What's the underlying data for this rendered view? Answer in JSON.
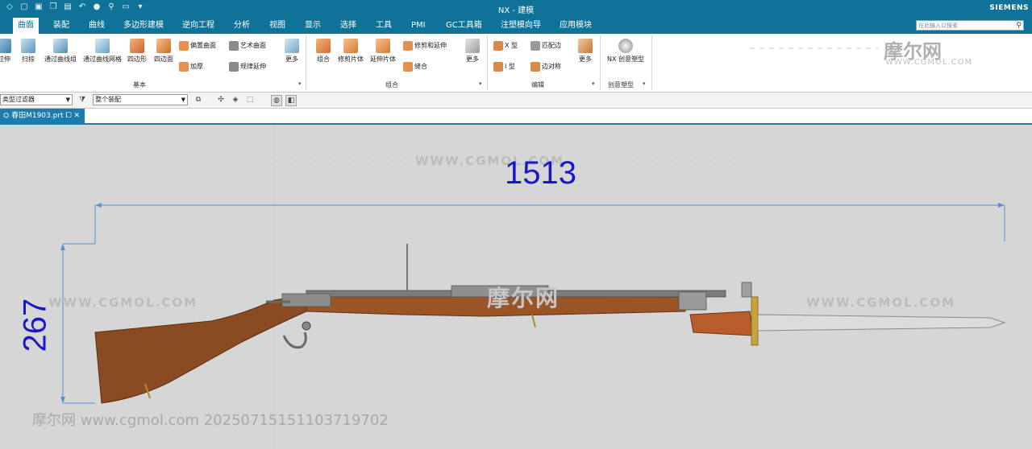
{
  "window": {
    "title": "NX - 建模",
    "brand": "SIEMENS"
  },
  "menu": {
    "tabs": [
      "曲面",
      "装配",
      "曲线",
      "多边形建模",
      "逆向工程",
      "分析",
      "视图",
      "显示",
      "选择",
      "工具",
      "PMI",
      "GC工具箱",
      "注塑模向导",
      "应用模块"
    ]
  },
  "search": {
    "placeholder": "在此输入以搜索"
  },
  "ribbon": {
    "basic": {
      "label": "基本",
      "buttons": [
        "拉伸",
        "扫掠",
        "通过曲线组",
        "通过曲线网格",
        "四边形",
        "四边面"
      ],
      "small": [
        "偏置曲面",
        "加厚",
        "艺术曲面",
        "规律延伸"
      ],
      "more": "更多"
    },
    "combine": {
      "label": "组合",
      "buttons": [
        "组合",
        "修剪片体",
        "延伸片体"
      ],
      "small": [
        "修剪和延伸",
        "缝合"
      ],
      "more": "更多"
    },
    "edit": {
      "label": "编辑",
      "small": [
        "X 型",
        "I 型",
        "匹配边",
        "边对称"
      ],
      "more": "更多"
    },
    "creative": {
      "label": "创意塑型",
      "button": "NX 创意塑型"
    }
  },
  "filter": {
    "type_filter": "类型过滤器",
    "scope": "整个装配"
  },
  "doc_tab": {
    "name": "春田M1903.prt"
  },
  "watermarks": {
    "logo": "摩尔网",
    "site": "WWW.CGMOL.COM",
    "footer": "摩尔网 www.cgmol.com 20250715151103719702"
  },
  "dimensions": {
    "width": "1513",
    "height": "267"
  },
  "colors": {
    "accent": "#0f7399",
    "dimension": "#1818c8",
    "wood": "#8a4a22"
  }
}
